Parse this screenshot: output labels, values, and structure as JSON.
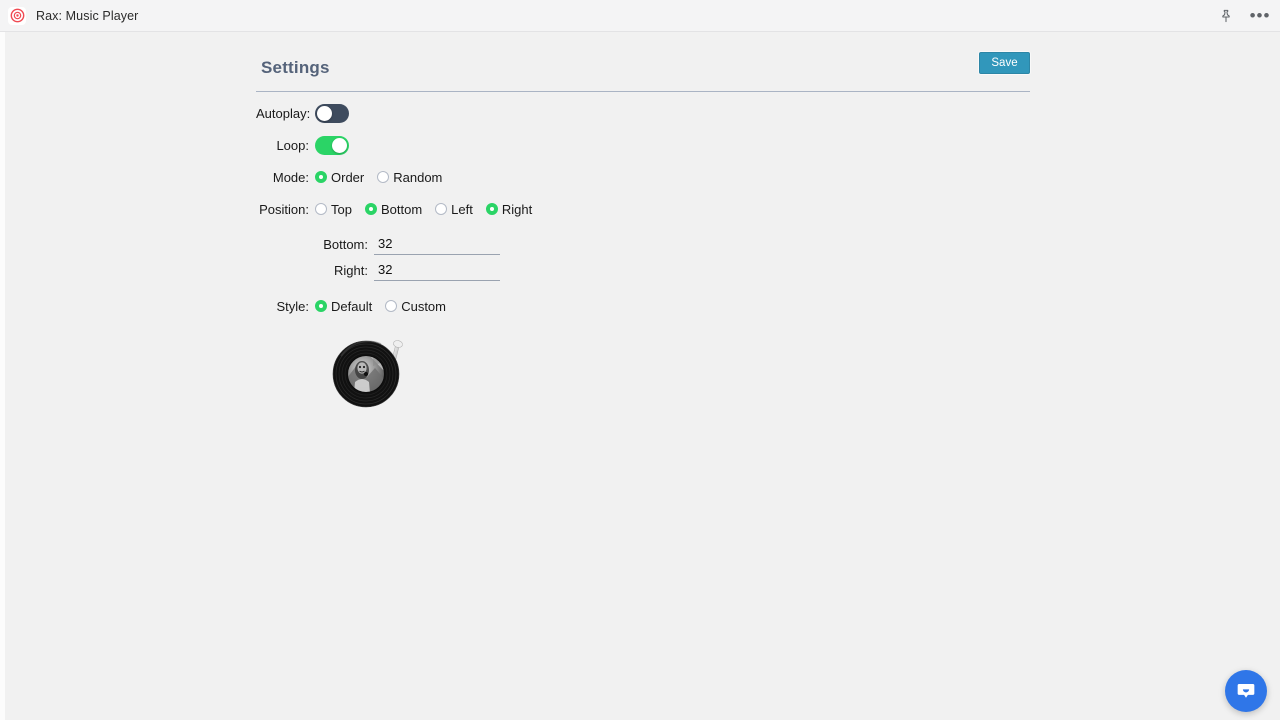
{
  "titlebar": {
    "app_icon_name": "record-target-icon",
    "title": "Rax: Music Player",
    "pin_icon_name": "pin-icon",
    "more_icon_name": "more-options-icon",
    "more_glyph": "•••"
  },
  "panel": {
    "title": "Settings",
    "save_label": "Save",
    "accent_color": "#3197bb",
    "title_color": "#55637a",
    "toggle_on_color": "#2bd466",
    "toggle_off_color": "#3e4b5e",
    "radio_checked_color": "#2bd466"
  },
  "fields": {
    "autoplay": {
      "label": "Autoplay:",
      "state": "off"
    },
    "loop": {
      "label": "Loop:",
      "state": "on"
    },
    "mode": {
      "label": "Mode:",
      "options": [
        {
          "label": "Order",
          "checked": true
        },
        {
          "label": "Random",
          "checked": false
        }
      ]
    },
    "position": {
      "label": "Position:",
      "options": [
        {
          "label": "Top",
          "checked": false
        },
        {
          "label": "Bottom",
          "checked": true
        },
        {
          "label": "Left",
          "checked": false
        },
        {
          "label": "Right",
          "checked": true
        }
      ]
    },
    "bottom_offset": {
      "label": "Bottom:",
      "value": "32",
      "placeholder": ""
    },
    "right_offset": {
      "label": "Right:",
      "value": "32",
      "placeholder": ""
    },
    "style": {
      "label": "Style:",
      "options": [
        {
          "label": "Default",
          "checked": true
        },
        {
          "label": "Custom",
          "checked": false
        }
      ],
      "preview_icon_name": "vinyl-record-preview"
    }
  },
  "chat_widget": {
    "icon_name": "chat-bubble-icon",
    "color": "#2f76e8"
  }
}
